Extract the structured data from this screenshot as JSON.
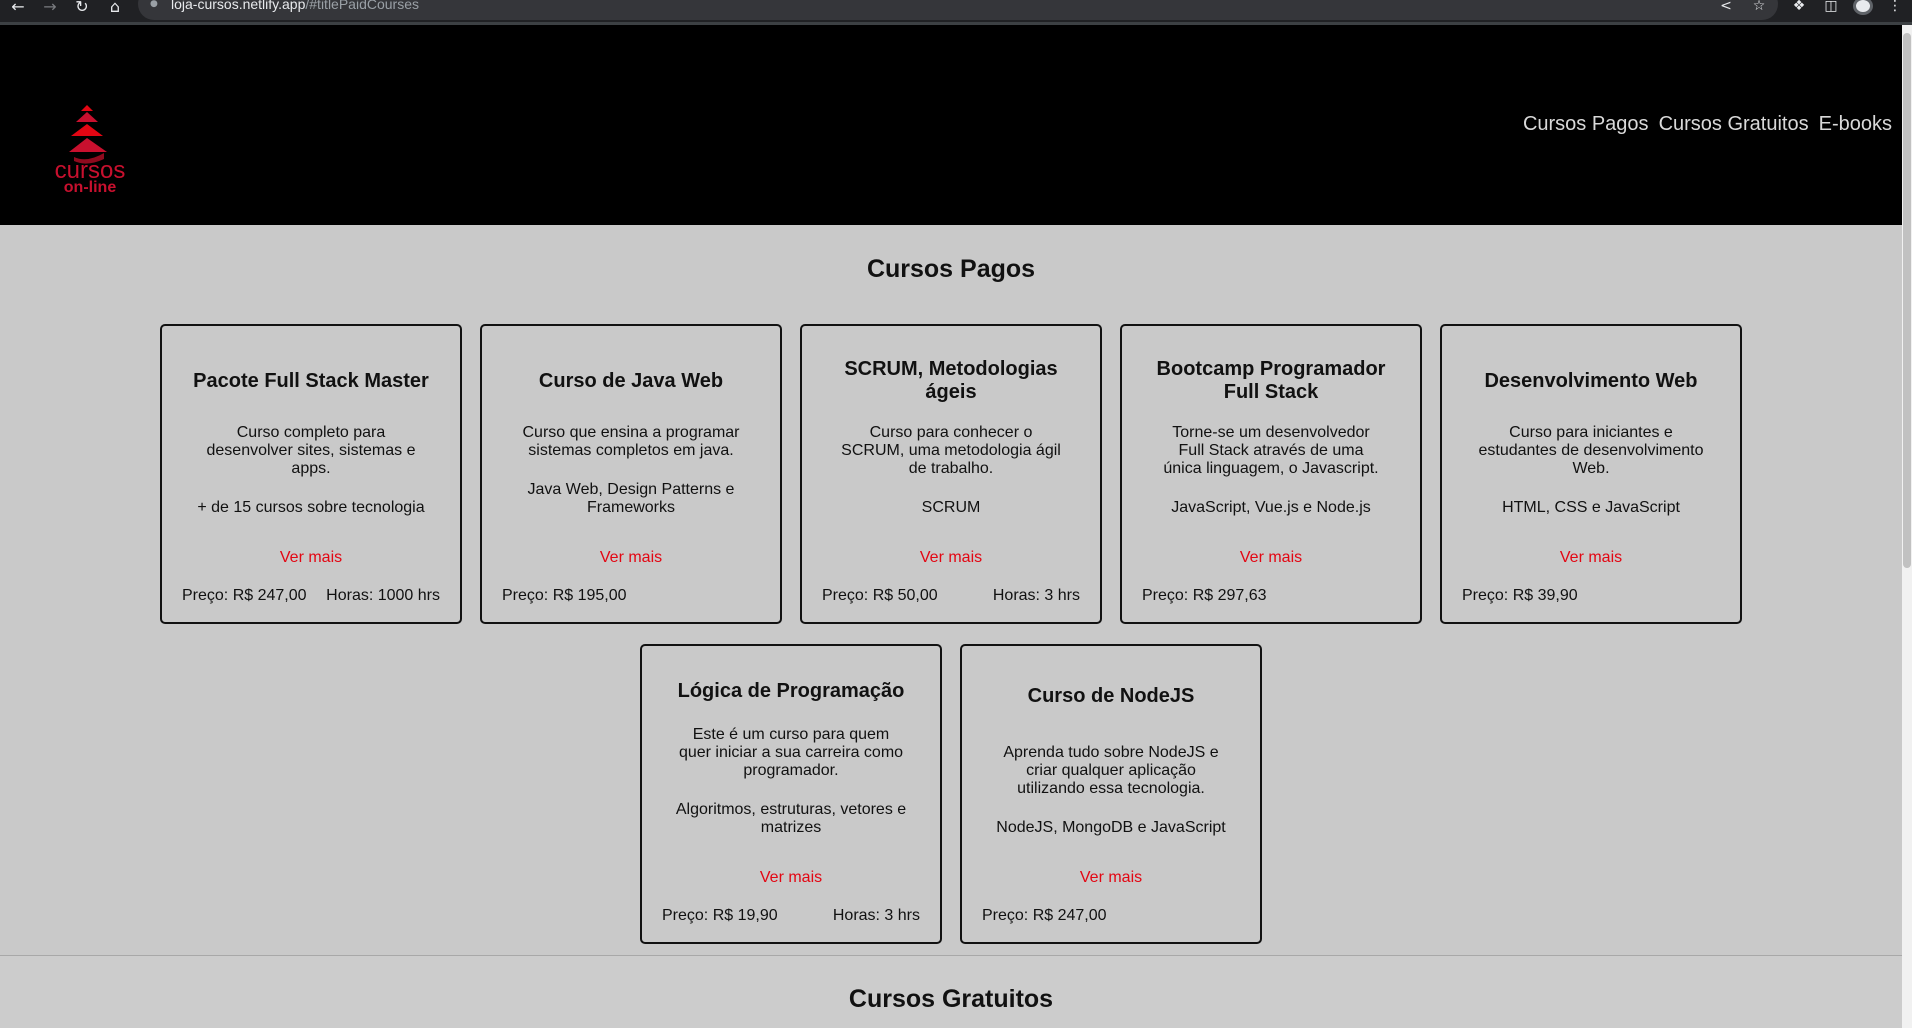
{
  "browser": {
    "url_host": "loja-cursos.netlify.app",
    "url_hash": "/#titlePaidCourses"
  },
  "header": {
    "logo_text_1": "cursos",
    "logo_text_2": "on-line",
    "nav": [
      "Cursos Pagos",
      "Cursos Gratuitos",
      "E-books"
    ]
  },
  "paid_section": {
    "title": "Cursos Pagos",
    "more_label": "Ver mais",
    "courses": [
      {
        "title": "Pacote Full Stack Master",
        "description": "Curso completo para desenvolver sites, sistemas e apps.",
        "topics": "+ de 15 cursos sobre tecnologia",
        "price": "Preço: R$ 247,00",
        "hours": "Horas: 1000 hrs"
      },
      {
        "title": "Curso de Java Web",
        "description": "Curso que ensina a programar sistemas completos em java.",
        "topics": "Java Web, Design Patterns e Frameworks",
        "price": "Preço: R$ 195,00",
        "hours": ""
      },
      {
        "title": "SCRUM, Metodologias ágeis",
        "description": "Curso para conhecer o SCRUM, uma metodologia ágil de trabalho.",
        "topics": "SCRUM",
        "price": "Preço: R$ 50,00",
        "hours": "Horas: 3 hrs"
      },
      {
        "title": "Bootcamp Programador Full Stack",
        "description": "Torne-se um desenvolvedor Full Stack através de uma única linguagem, o Javascript.",
        "topics": "JavaScript, Vue.js e Node.js",
        "price": "Preço: R$ 297,63",
        "hours": ""
      },
      {
        "title": "Desenvolvimento Web",
        "description": "Curso para iniciantes e estudantes de desenvolvimento Web.",
        "topics": "HTML, CSS e JavaScript",
        "price": "Preço: R$ 39,90",
        "hours": ""
      },
      {
        "title": "Lógica de Programação",
        "description": "Este é um curso para quem quer iniciar a sua carreira como programador.",
        "topics": "Algoritmos, estruturas, vetores e matrizes",
        "price": "Preço: R$ 19,90",
        "hours": "Horas: 3 hrs"
      },
      {
        "title": "Curso de NodeJS",
        "description": "Aprenda tudo sobre NodeJS e criar qualquer aplicação utilizando essa tecnologia.",
        "topics": "NodeJS, MongoDB e JavaScript",
        "price": "Preço: R$ 247,00",
        "hours": ""
      }
    ]
  },
  "free_section": {
    "title": "Cursos Gratuitos"
  },
  "colors": {
    "header_bg": "#000000",
    "page_bg": "#c9c9c9",
    "accent": "#e30613",
    "logo": "#c8102e"
  }
}
